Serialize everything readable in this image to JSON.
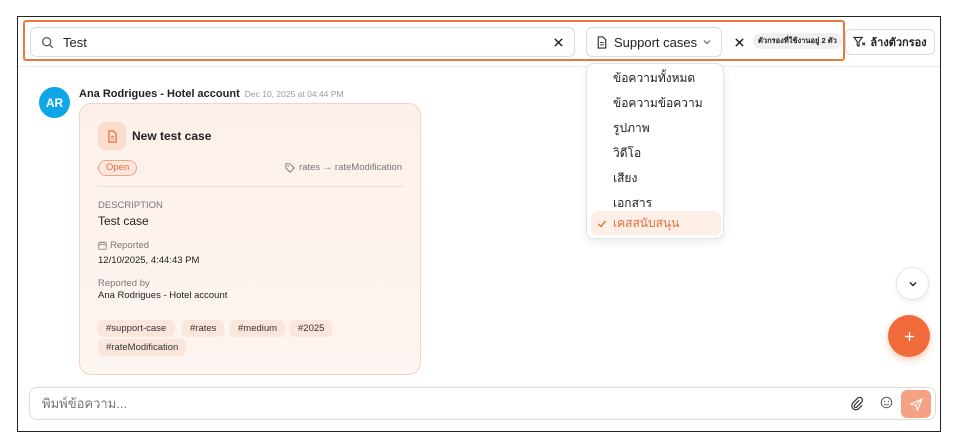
{
  "filter": {
    "search_value": "Test",
    "type_selected": "Support cases",
    "active_badge": "ตัวกรองที่ใช้งานอยู่ 2 ตัว",
    "clear_label": "ล้างตัวกรอง"
  },
  "dropdown": {
    "items": [
      {
        "label": "ข้อความทั้งหมด",
        "selected": false
      },
      {
        "label": "ข้อความข้อความ",
        "selected": false
      },
      {
        "label": "รูปภาพ",
        "selected": false
      },
      {
        "label": "วิดีโอ",
        "selected": false
      },
      {
        "label": "เสียง",
        "selected": false
      },
      {
        "label": "เอกสาร",
        "selected": false
      },
      {
        "label": "เคสสนับสนุน",
        "selected": true
      }
    ]
  },
  "message": {
    "avatar_initials": "AR",
    "sender": "Ana Rodrigues - Hotel account",
    "timestamp": "Dec 10, 2025 at 04:44 PM"
  },
  "case_card": {
    "title": "New test case",
    "status": "Open",
    "route": "rates → rateModification",
    "description_label": "DESCRIPTION",
    "description": "Test case",
    "reported_label": "Reported",
    "reported_value": "12/10/2025, 4:44:43 PM",
    "reported_by_label": "Reported by",
    "reported_by_value": "Ana Rodrigues - Hotel account",
    "tags": [
      "#support-case",
      "#rates",
      "#medium",
      "#2025",
      "#rateModification"
    ]
  },
  "composer": {
    "placeholder": "พิมพ์ข้อความ..."
  },
  "colors": {
    "accent": "#f16a3a",
    "highlight_border": "#e87a3c",
    "avatar": "#0ea5e9"
  }
}
